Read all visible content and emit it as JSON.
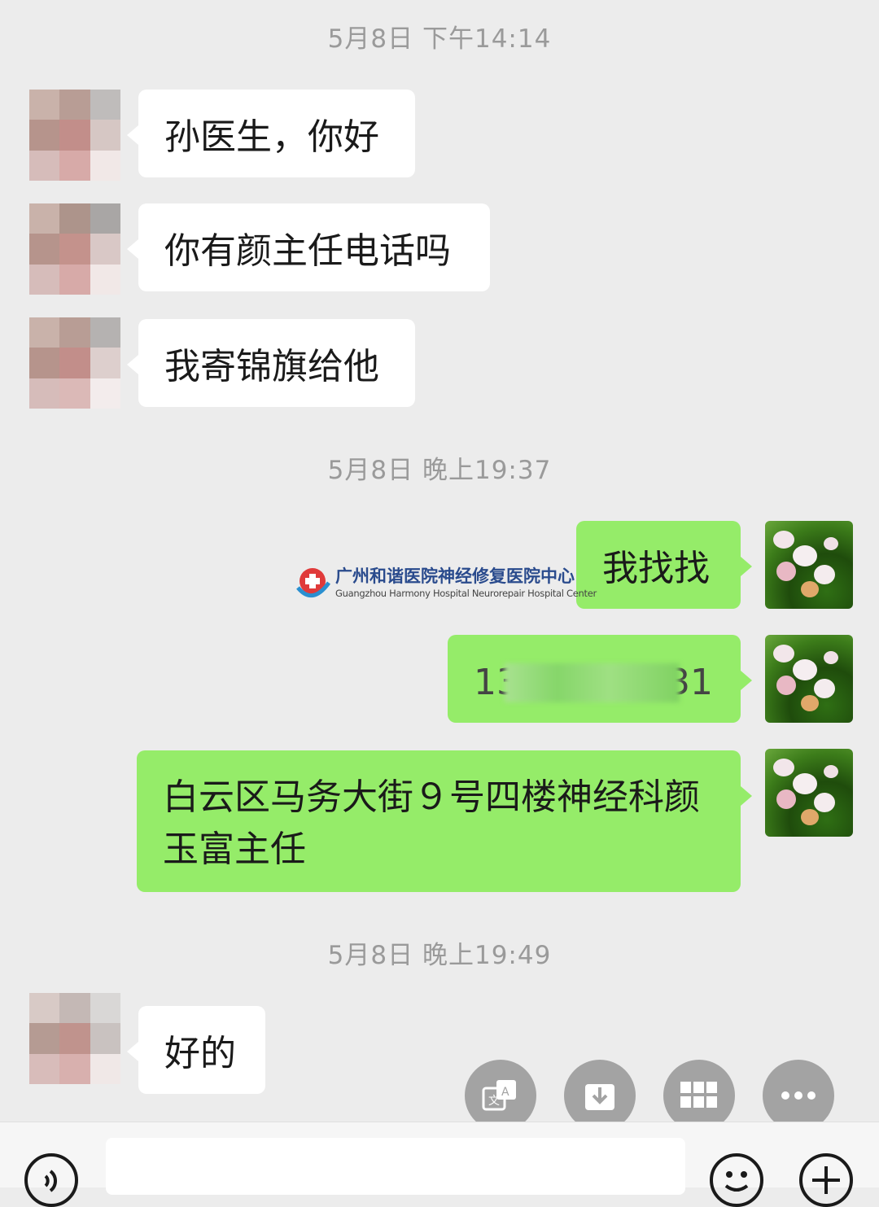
{
  "timestamps": [
    "5月8日 下午14:14",
    "5月8日 晚上19:37",
    "5月8日 晚上19:49"
  ],
  "messages": {
    "m1": "孙医生，你好",
    "m2": "你有颜主任电话吗",
    "m3": "我寄锦旗给他",
    "m4": "我找找",
    "m5_prefix": "13",
    "m5_suffix": "31",
    "m6_line1": "白云区马务大街９号四楼神经科颜",
    "m6_line2": "玉富主任",
    "m7": "好的"
  },
  "watermark": {
    "cn": "广州和谐医院神经修复医院中心",
    "en": "Guangzhou Harmony Hospital Neurorepair Hospital Center"
  },
  "quick_actions": [
    "translate-icon",
    "save-icon",
    "apps-icon",
    "more-icon"
  ],
  "bottom_bar": [
    "voice-icon",
    "emoji-icon",
    "plus-icon"
  ],
  "colors": {
    "outgoing": "#95ec69",
    "incoming": "#ffffff",
    "background": "#ececec"
  }
}
